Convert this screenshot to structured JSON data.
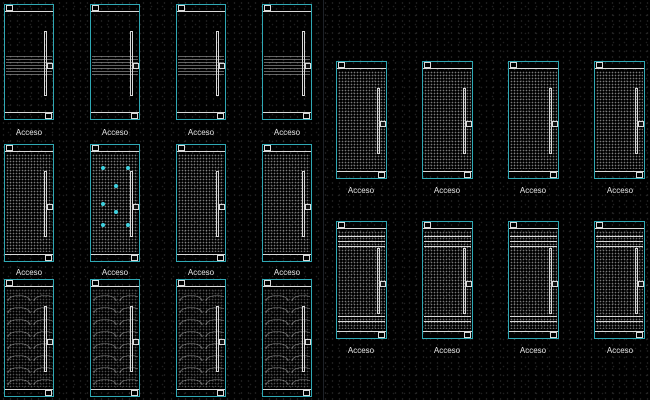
{
  "caption_text": "Acceso",
  "colors": {
    "background": "#000000",
    "frame": "#2fa8b4",
    "lines": "#d9d9d9",
    "accent": "#3fd2e0"
  },
  "doors": [
    {
      "name": "door-left-r1-c1",
      "style": "band"
    },
    {
      "name": "door-left-r1-c2",
      "style": "band"
    },
    {
      "name": "door-left-r1-c3",
      "style": "band"
    },
    {
      "name": "door-left-r1-c4",
      "style": "band"
    },
    {
      "name": "door-left-r2-c1",
      "style": "full"
    },
    {
      "name": "door-left-r2-c2",
      "style": "stars"
    },
    {
      "name": "door-left-r2-c3",
      "style": "full"
    },
    {
      "name": "door-left-r2-c4",
      "style": "full"
    },
    {
      "name": "door-left-r3-c1",
      "style": "wave"
    },
    {
      "name": "door-left-r3-c2",
      "style": "wave"
    },
    {
      "name": "door-left-r3-c3",
      "style": "wave"
    },
    {
      "name": "door-left-r3-c4",
      "style": "wave"
    },
    {
      "name": "door-right-r1-c1",
      "style": "full"
    },
    {
      "name": "door-right-r1-c2",
      "style": "full"
    },
    {
      "name": "door-right-r1-c3",
      "style": "full"
    },
    {
      "name": "door-right-r1-c4",
      "style": "full"
    },
    {
      "name": "door-right-r2-c1",
      "style": "full-stripes"
    },
    {
      "name": "door-right-r2-c2",
      "style": "full-stripes"
    },
    {
      "name": "door-right-r2-c3",
      "style": "full-stripes"
    },
    {
      "name": "door-right-r2-c4",
      "style": "full-stripes"
    }
  ],
  "captions": [
    {
      "name": "caption-left-r1-c1",
      "text": "Acceso"
    },
    {
      "name": "caption-left-r1-c2",
      "text": "Acceso"
    },
    {
      "name": "caption-left-r1-c3",
      "text": "Acceso"
    },
    {
      "name": "caption-left-r1-c4",
      "text": "Acceso"
    },
    {
      "name": "caption-left-r2-c1",
      "text": "Acceso"
    },
    {
      "name": "caption-left-r2-c2",
      "text": "Acceso"
    },
    {
      "name": "caption-left-r2-c3",
      "text": "Acceso"
    },
    {
      "name": "caption-left-r2-c4",
      "text": "Acceso"
    },
    {
      "name": "caption-right-r1-c1",
      "text": "Acceso"
    },
    {
      "name": "caption-right-r1-c2",
      "text": "Acceso"
    },
    {
      "name": "caption-right-r1-c3",
      "text": "Acceso"
    },
    {
      "name": "caption-right-r1-c4",
      "text": "Acceso"
    },
    {
      "name": "caption-right-r2-c1",
      "text": "Acceso"
    },
    {
      "name": "caption-right-r2-c2",
      "text": "Acceso"
    },
    {
      "name": "caption-right-r2-c3",
      "text": "Acceso"
    },
    {
      "name": "caption-right-r2-c4",
      "text": "Acceso"
    }
  ]
}
